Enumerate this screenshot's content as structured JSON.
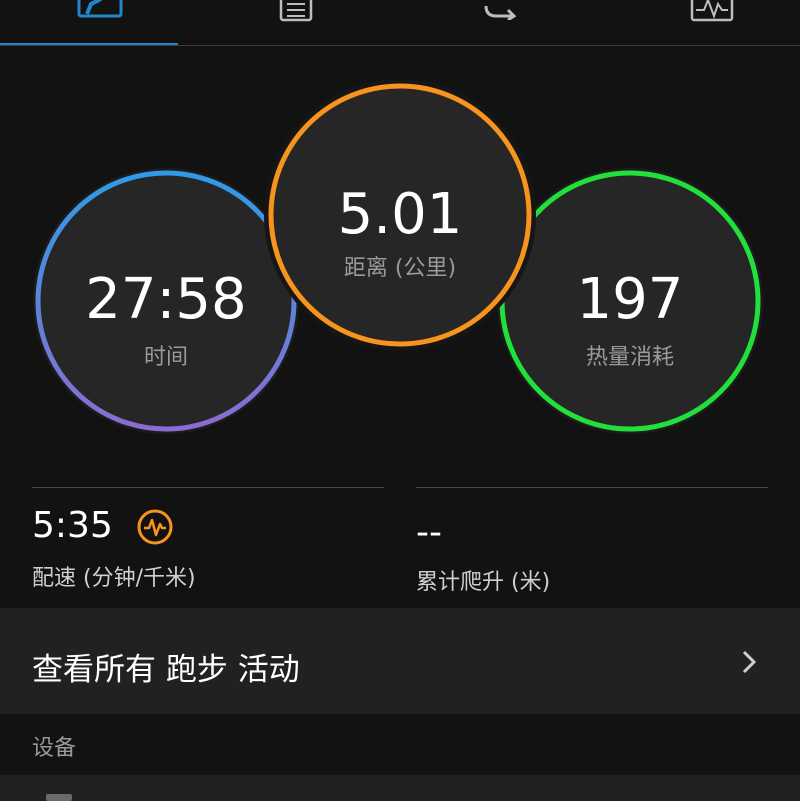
{
  "tabs": [
    {
      "icon": "dashboard-icon",
      "active": true
    },
    {
      "icon": "list-icon",
      "active": false
    },
    {
      "icon": "sync-icon",
      "active": false
    },
    {
      "icon": "chart-icon",
      "active": false
    }
  ],
  "metrics": {
    "time": {
      "value": "27:58",
      "label": "时间"
    },
    "distance": {
      "value": "5.01",
      "label": "距离 (公里)"
    },
    "calories": {
      "value": "197",
      "label": "热量消耗"
    }
  },
  "stats": {
    "pace": {
      "value": "5:35",
      "label": "配速 (分钟/千米)",
      "icon": "heart-rate-icon"
    },
    "elevation": {
      "value": "--",
      "label": "累计爬升 (米)"
    }
  },
  "view_all": {
    "label": "查看所有 跑步 活动"
  },
  "devices_section": {
    "title": "设备"
  },
  "colors": {
    "accent": "#1e88c8",
    "time_ring_top": "#2f9be6",
    "time_ring_bottom": "#8a6dd0",
    "distance_ring": "#f7941d",
    "calories_ring": "#22e03c",
    "pace_icon": "#f7941d"
  }
}
